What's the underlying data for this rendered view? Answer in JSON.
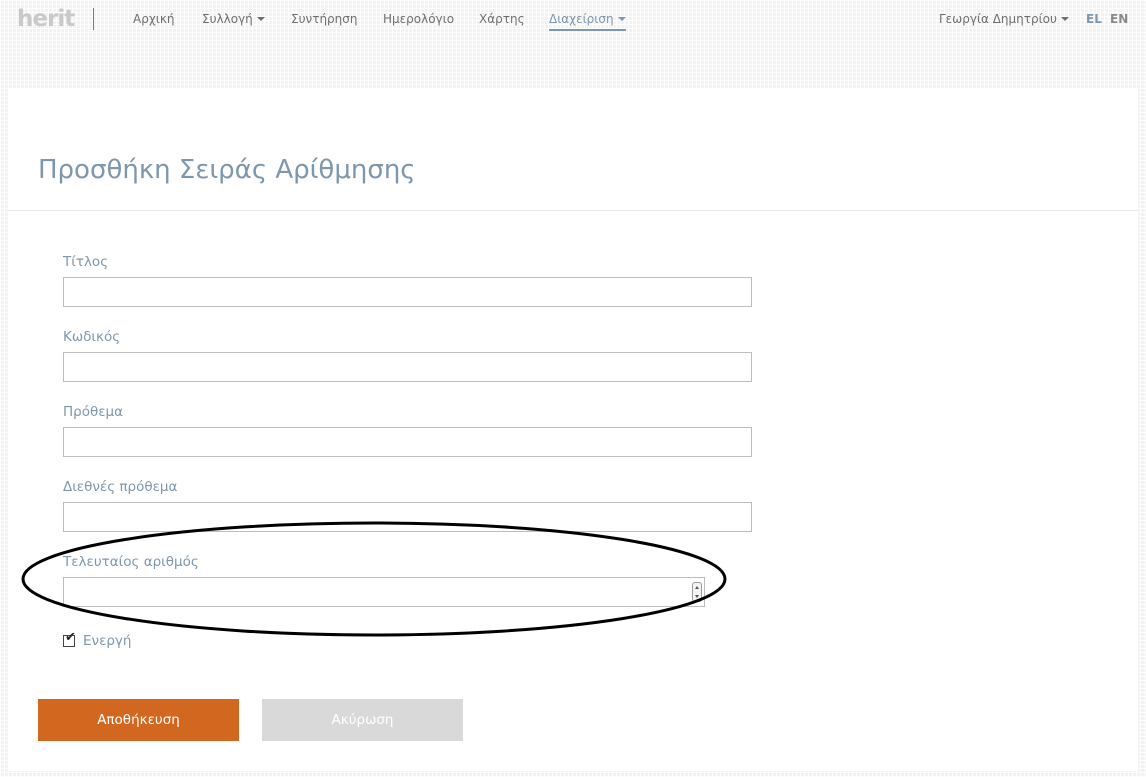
{
  "brand": {
    "logo_text": "herit"
  },
  "nav": {
    "items": [
      {
        "label": "Αρχική",
        "has_caret": false,
        "active": false
      },
      {
        "label": "Συλλογή",
        "has_caret": true,
        "active": false
      },
      {
        "label": "Συντήρηση",
        "has_caret": false,
        "active": false
      },
      {
        "label": "Ημερολόγιο",
        "has_caret": false,
        "active": false
      },
      {
        "label": "Χάρτης",
        "has_caret": false,
        "active": false
      },
      {
        "label": "Διαχείριση",
        "has_caret": true,
        "active": true
      }
    ],
    "user_name": "Γεωργία Δημητρίου",
    "languages": [
      {
        "code": "EL",
        "active": true
      },
      {
        "code": "EN",
        "active": false
      }
    ]
  },
  "page": {
    "title": "Προσθήκη Σειράς Αρίθμησης"
  },
  "form": {
    "fields": [
      {
        "label": "Τίτλος",
        "value": ""
      },
      {
        "label": "Κωδικός",
        "value": ""
      },
      {
        "label": "Πρόθεμα",
        "value": ""
      },
      {
        "label": "Διεθνές πρόθεμα",
        "value": ""
      },
      {
        "label": "Τελευταίος αριθμός",
        "value": ""
      }
    ],
    "active_checkbox": {
      "label": "Ενεργή",
      "checked": true
    },
    "save_label": "Αποθήκευση",
    "cancel_label": "Ακύρωση"
  },
  "colors": {
    "accent": "#7d97ad",
    "primary_button": "#d2681f",
    "disabled_button": "#d9d9d9",
    "annotation_stroke": "#000000"
  },
  "icons": {
    "nav_dropdown": "caret-down-icon",
    "number_spinner": "spinner-arrows-icon",
    "checkbox": "checkmark-icon"
  }
}
